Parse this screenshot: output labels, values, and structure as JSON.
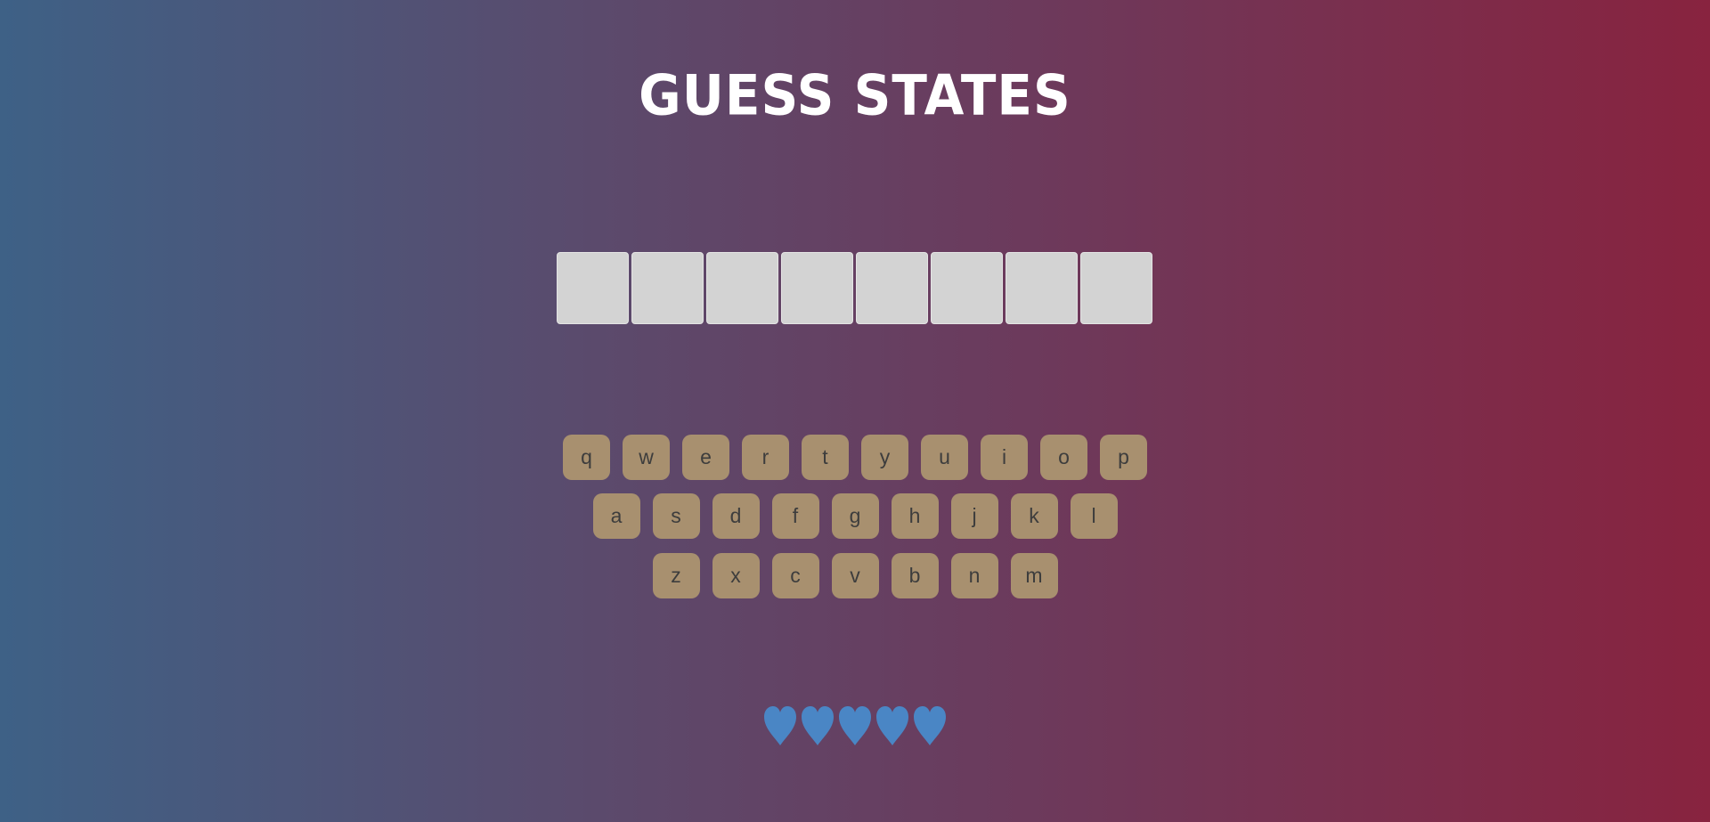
{
  "header": {
    "title": "GUESS STATES"
  },
  "answer": {
    "letter_count": 8,
    "revealed": [
      "",
      "",
      "",
      "",
      "",
      "",
      "",
      ""
    ]
  },
  "keyboard": {
    "rows": [
      [
        "q",
        "w",
        "e",
        "r",
        "t",
        "y",
        "u",
        "i",
        "o",
        "p"
      ],
      [
        "a",
        "s",
        "d",
        "f",
        "g",
        "h",
        "j",
        "k",
        "l"
      ],
      [
        "z",
        "x",
        "c",
        "v",
        "b",
        "n",
        "m"
      ]
    ]
  },
  "lives": {
    "count": 5,
    "icon": "heart-icon",
    "color": "#4a86c5"
  },
  "colors": {
    "key_bg": "#a8906f",
    "key_text": "#3d3d3d",
    "slot_bg": "#d3d3d3",
    "title": "#ffffff"
  }
}
